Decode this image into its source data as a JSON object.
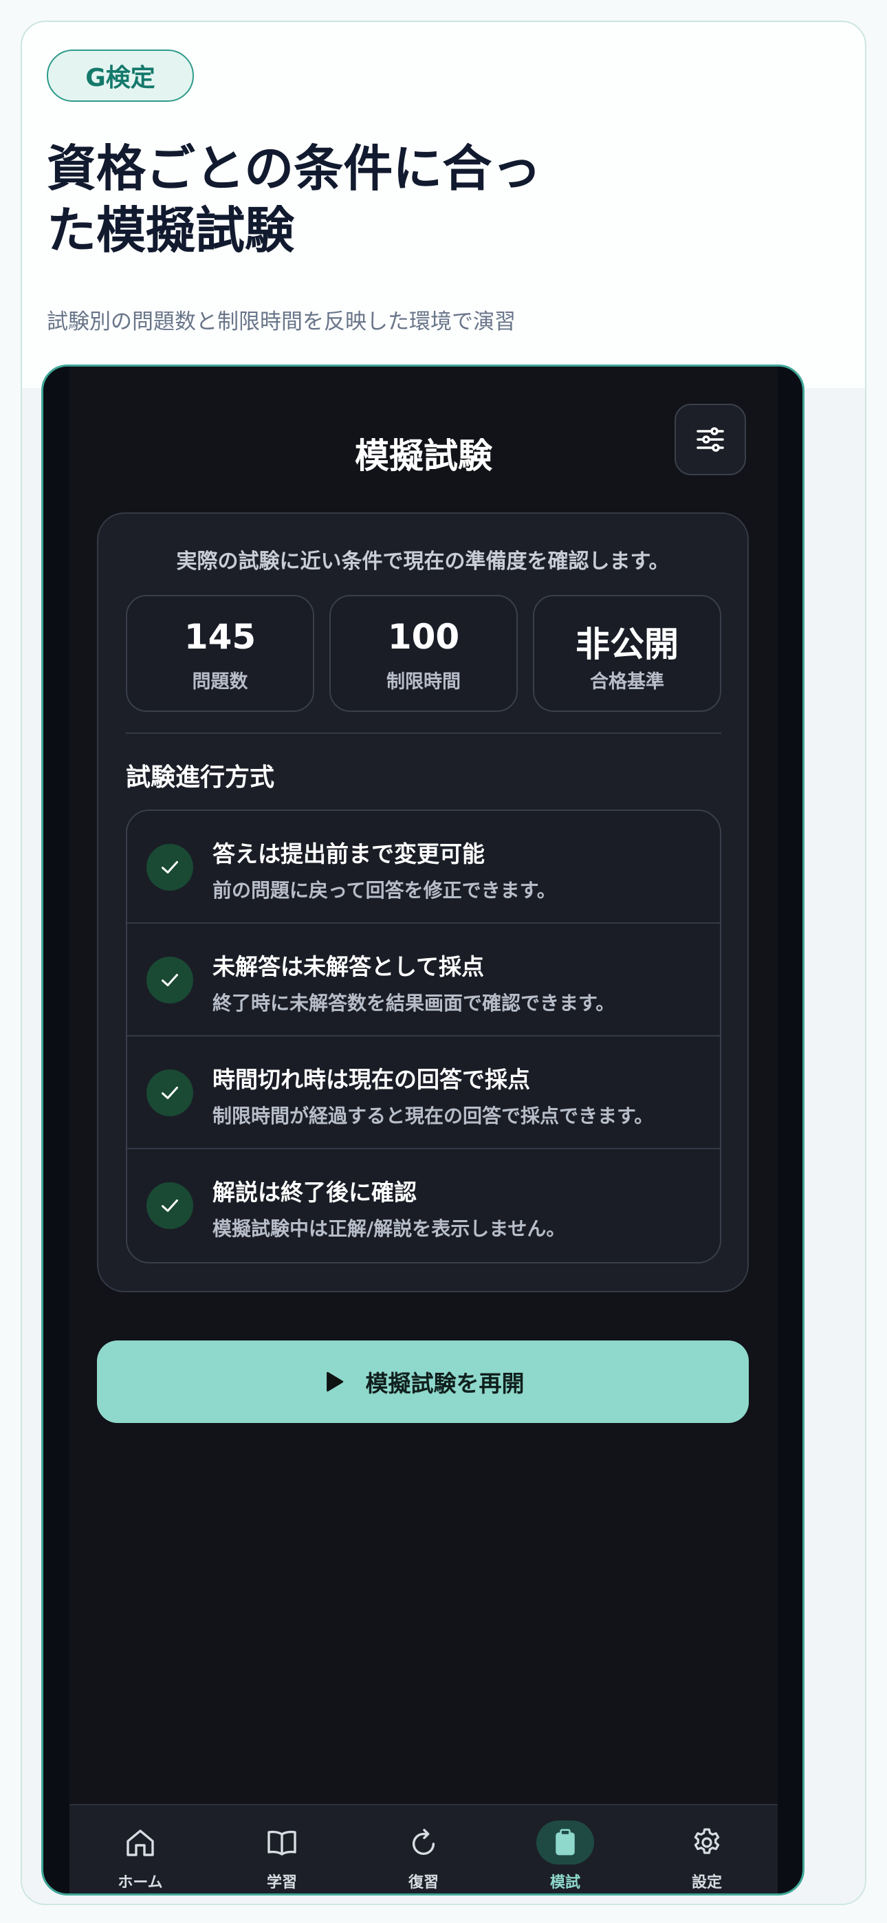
{
  "hero": {
    "badge": "G検定",
    "headline": "資格ごとの条件に合った模擬試験",
    "subtext": "試験別の問題数と制限時間を反映した環境で演習"
  },
  "screen": {
    "title": "模擬試験",
    "settings_icon": "sliders-icon",
    "intro": "実際の試験に近い条件で現在の準備度を確認します。",
    "stats": [
      {
        "value": "145",
        "label": "問題数"
      },
      {
        "value": "100",
        "label": "制限時間"
      },
      {
        "value": "非公開",
        "label": "合格基準"
      }
    ],
    "section_title": "試験進行方式",
    "rules": [
      {
        "title": "答えは提出前まで変更可能",
        "desc": "前の問題に戻って回答を修正できます。"
      },
      {
        "title": "未解答は未解答として採点",
        "desc": "終了時に未解答数を結果画面で確認できます。"
      },
      {
        "title": "時間切れ時は現在の回答で採点",
        "desc": "制限時間が経過すると現在の回答で採点できます。"
      },
      {
        "title": "解説は終了後に確認",
        "desc": "模擬試験中は正解/解説を表示しません。"
      }
    ],
    "resume_label": "模擬試験を再開"
  },
  "nav": {
    "items": [
      {
        "label": "ホーム",
        "icon": "home-icon"
      },
      {
        "label": "学習",
        "icon": "book-icon"
      },
      {
        "label": "復習",
        "icon": "refresh-icon"
      },
      {
        "label": "模試",
        "icon": "clipboard-icon"
      },
      {
        "label": "設定",
        "icon": "gear-icon"
      }
    ],
    "active_index": 3
  },
  "colors": {
    "accent": "#8fd8cc",
    "teal_border": "#3fa697",
    "screen_bg": "#111318",
    "card_bg": "#1c1f28",
    "check_bg": "#1a4a34"
  }
}
